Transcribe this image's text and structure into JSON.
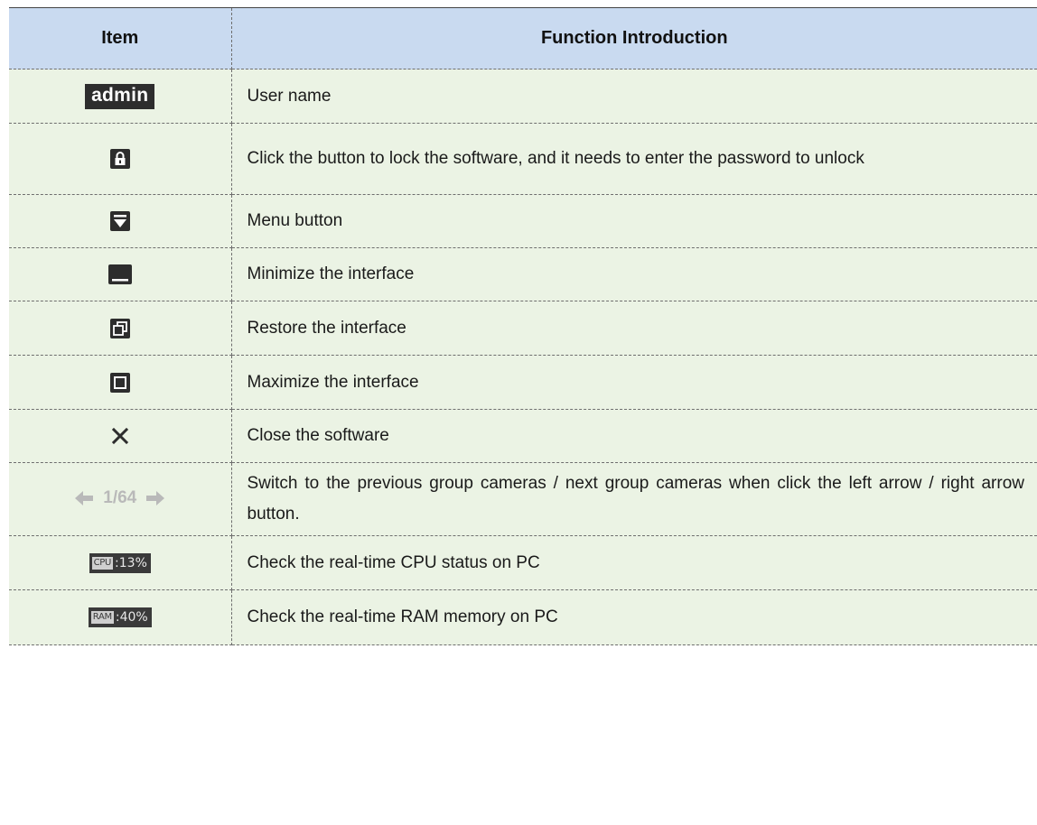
{
  "table": {
    "headers": {
      "item": "Item",
      "function": "Function Introduction"
    },
    "rows": [
      {
        "icon": "admin-username-badge",
        "item_text": "admin",
        "description": "User name"
      },
      {
        "icon": "lock-icon",
        "description": "Click the button to lock the software, and it needs to enter the password to unlock"
      },
      {
        "icon": "menu-dropdown-icon",
        "description": "Menu button"
      },
      {
        "icon": "minimize-icon",
        "description": "Minimize the interface"
      },
      {
        "icon": "restore-icon",
        "description": "Restore the interface"
      },
      {
        "icon": "maximize-icon",
        "description": "Maximize the interface"
      },
      {
        "icon": "close-icon",
        "description": "Close the software"
      },
      {
        "icon": "group-pager",
        "item_text": "1/64",
        "description": "Switch to the previous group cameras / next group cameras when click the left arrow / right arrow button."
      },
      {
        "icon": "cpu-meter",
        "tag": "CPU",
        "item_text": ":13%",
        "description": "Check the real-time CPU status on PC"
      },
      {
        "icon": "ram-meter",
        "tag": "RAM",
        "item_text": ":40%",
        "description": "Check the real-time RAM memory on PC"
      }
    ]
  },
  "colors": {
    "header_bg": "#c9daf0",
    "row_bg": "#ebf3e4",
    "icon_bg": "#2d2d2d",
    "pager_arrow": "#b9b9b9"
  }
}
